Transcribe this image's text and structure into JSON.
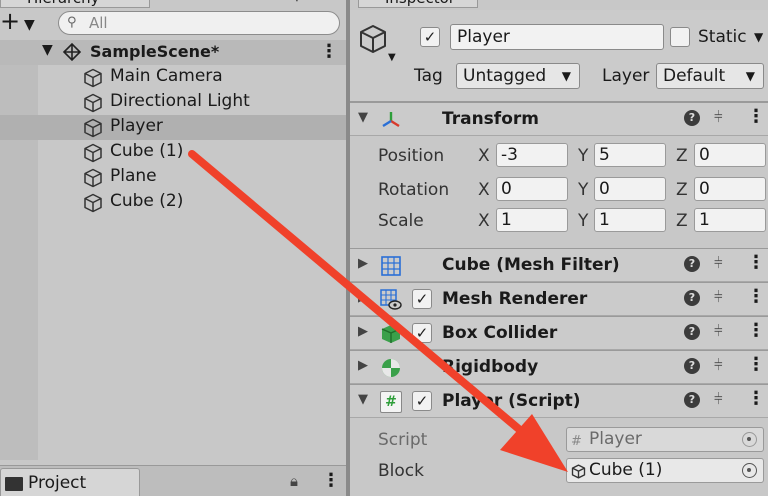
{
  "hierarchy": {
    "tab_label": "Hierarchy",
    "search_placeholder": "All",
    "scene": {
      "name": "SampleScene*"
    },
    "items": [
      {
        "label": "Main Camera"
      },
      {
        "label": "Directional Light"
      },
      {
        "label": "Player",
        "selected": true
      },
      {
        "label": "Cube (1)"
      },
      {
        "label": "Plane"
      },
      {
        "label": "Cube (2)"
      }
    ]
  },
  "project_tab": {
    "label": "Project"
  },
  "inspector": {
    "tab_label": "Inspector",
    "object": {
      "active": true,
      "name": "Player",
      "static_label": "Static",
      "tag_label": "Tag",
      "tag_value": "Untagged",
      "layer_label": "Layer",
      "layer_value": "Default"
    },
    "transform": {
      "title": "Transform",
      "position": {
        "label": "Position",
        "x": "-3",
        "y": "5",
        "z": "0"
      },
      "rotation": {
        "label": "Rotation",
        "x": "0",
        "y": "0",
        "z": "0"
      },
      "scale": {
        "label": "Scale",
        "x": "1",
        "y": "1",
        "z": "1"
      },
      "axis_labels": {
        "x": "X",
        "y": "Y",
        "z": "Z"
      }
    },
    "components": [
      {
        "title": "Cube (Mesh Filter)",
        "has_checkbox": false,
        "icon": "mesh-filter-icon"
      },
      {
        "title": "Mesh Renderer",
        "has_checkbox": true,
        "icon": "mesh-renderer-icon"
      },
      {
        "title": "Box Collider",
        "has_checkbox": true,
        "icon": "box-collider-icon"
      },
      {
        "title": "Rigidbody",
        "has_checkbox": false,
        "icon": "rigidbody-icon"
      }
    ],
    "script_component": {
      "title": "Player (Script)",
      "script_label": "Script",
      "script_value": "Player",
      "block_label": "Block",
      "block_value": "Cube (1)"
    }
  },
  "colors": {
    "arrow": "#f0412a",
    "selection": "#b0b0b0"
  }
}
